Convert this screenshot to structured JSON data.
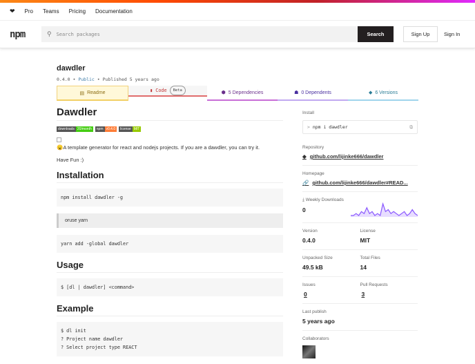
{
  "nav": {
    "items": [
      "Pro",
      "Teams",
      "Pricing",
      "Documentation"
    ]
  },
  "header": {
    "logo": "npm",
    "search_placeholder": "Search packages",
    "search_button": "Search",
    "signup": "Sign Up",
    "signin": "Sign In"
  },
  "package": {
    "name": "dawdler",
    "version": "0.4.0",
    "visibility": "Public",
    "published": "Published 5 years ago"
  },
  "tabs": [
    {
      "label": "Readme"
    },
    {
      "label": "Code",
      "badge": "Beta"
    },
    {
      "label": "5 Dependencies"
    },
    {
      "label": "0 Dependents"
    },
    {
      "label": "6 Versions"
    }
  ],
  "readme": {
    "title": "Dawdler",
    "badges": [
      {
        "k": "downloads",
        "v": "20/month",
        "color": "#4c1"
      },
      {
        "k": "npm",
        "v": "v0.4.0",
        "color": "#fe7d37"
      },
      {
        "k": "license",
        "v": "MIT",
        "color": "#97ca00"
      }
    ],
    "intro": "😦A template generator for react and nodejs projects. If you are a dawdler, you can try it.",
    "fun": "Have Fun :)",
    "h_install": "Installation",
    "install_cmd": "npm install dawdler -g",
    "quote": "oruse yarn",
    "yarn_cmd": "yarn add -global dawdler",
    "h_usage": "Usage",
    "usage_cmd": "$ [dl | dawdler] <command>",
    "h_example": "Example",
    "example_lines": [
      "$ dl init",
      "? Project name dawdler",
      "? Select project type REACT"
    ]
  },
  "sidebar": {
    "install_label": "Install",
    "install_cmd": "npm i dawdler",
    "repo_label": "Repository",
    "repo": "github.com/lijinke666/dawdler",
    "home_label": "Homepage",
    "home": "github.com/lijinke666/dawdler#READ...",
    "weekly_label": "Weekly Downloads",
    "weekly": "0",
    "weekly_series": [
      0,
      0,
      1,
      0,
      2,
      1,
      4,
      1,
      2,
      0,
      1,
      0,
      6,
      2,
      3,
      1,
      2,
      1,
      0,
      1,
      2,
      0,
      1,
      3,
      1,
      0
    ],
    "version_label": "Version",
    "version": "0.4.0",
    "license_label": "License",
    "license": "MIT",
    "size_label": "Unpacked Size",
    "size": "49.5 kB",
    "files_label": "Total Files",
    "files": "14",
    "issues_label": "Issues",
    "issues": "0",
    "prs_label": "Pull Requests",
    "prs": "3",
    "publish_label": "Last publish",
    "publish": "5 years ago",
    "collab_label": "Collaborators"
  }
}
